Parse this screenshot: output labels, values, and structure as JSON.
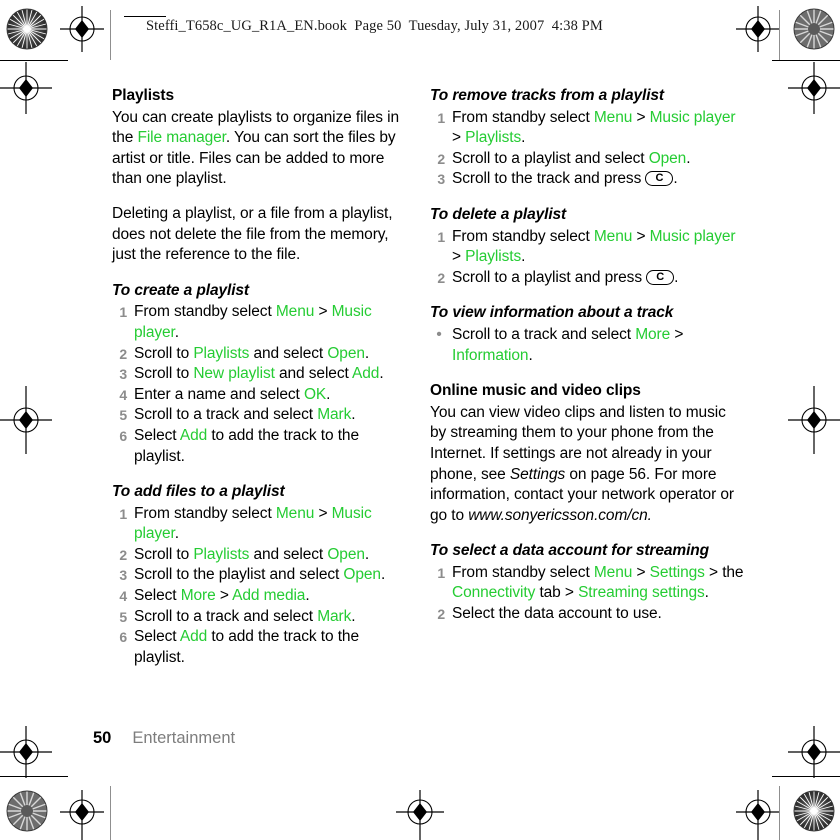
{
  "page_header": "Steffi_T658c_UG_R1A_EN.book  Page 50  Tuesday, July 31, 2007  4:38 PM",
  "colors": {
    "ui_term_green": "#25cc33",
    "step_number_gray": "#8c8c8c",
    "footer_title_gray": "#7d7d7d",
    "body_black": "#000000"
  },
  "left_column": {
    "playlists": {
      "title": "Playlists",
      "paragraph_1": {
        "part_1": "You can create playlists to organize files in the ",
        "ui_1": "File manager",
        "part_2": ". You can sort the files by artist or title. Files can be added to more than one playlist."
      },
      "paragraph_2": "Deleting a playlist, or a file from a playlist, does not delete the file from the memory, just the reference to the file."
    },
    "to_create_a_playlist": {
      "title": "To create a playlist",
      "steps": [
        {
          "num": "1",
          "segments": [
            {
              "t": "From standby select ",
              "s": "plain"
            },
            {
              "t": "Menu",
              "s": "ui"
            },
            {
              "t": " > ",
              "s": "plain"
            },
            {
              "t": "Music player",
              "s": "ui"
            },
            {
              "t": ".",
              "s": "plain"
            }
          ]
        },
        {
          "num": "2",
          "segments": [
            {
              "t": "Scroll to ",
              "s": "plain"
            },
            {
              "t": "Playlists",
              "s": "ui"
            },
            {
              "t": " and select ",
              "s": "plain"
            },
            {
              "t": "Open",
              "s": "ui"
            },
            {
              "t": ".",
              "s": "plain"
            }
          ]
        },
        {
          "num": "3",
          "segments": [
            {
              "t": "Scroll to ",
              "s": "plain"
            },
            {
              "t": "New playlist",
              "s": "ui"
            },
            {
              "t": " and select ",
              "s": "plain"
            },
            {
              "t": "Add",
              "s": "ui"
            },
            {
              "t": ".",
              "s": "plain"
            }
          ]
        },
        {
          "num": "4",
          "segments": [
            {
              "t": "Enter a name and select ",
              "s": "plain"
            },
            {
              "t": "OK",
              "s": "ui"
            },
            {
              "t": ".",
              "s": "plain"
            }
          ]
        },
        {
          "num": "5",
          "segments": [
            {
              "t": "Scroll to a track and select ",
              "s": "plain"
            },
            {
              "t": "Mark",
              "s": "ui"
            },
            {
              "t": ".",
              "s": "plain"
            }
          ]
        },
        {
          "num": "6",
          "segments": [
            {
              "t": "Select ",
              "s": "plain"
            },
            {
              "t": "Add",
              "s": "ui"
            },
            {
              "t": " to add the track to the playlist.",
              "s": "plain"
            }
          ]
        }
      ]
    },
    "to_add_files_to_a_playlist": {
      "title": "To add files to a playlist",
      "steps": [
        {
          "num": "1",
          "segments": [
            {
              "t": "From standby select ",
              "s": "plain"
            },
            {
              "t": "Menu",
              "s": "ui"
            },
            {
              "t": " > ",
              "s": "plain"
            },
            {
              "t": "Music player",
              "s": "ui"
            },
            {
              "t": ".",
              "s": "plain"
            }
          ]
        },
        {
          "num": "2",
          "segments": [
            {
              "t": "Scroll to ",
              "s": "plain"
            },
            {
              "t": "Playlists",
              "s": "ui"
            },
            {
              "t": " and select ",
              "s": "plain"
            },
            {
              "t": "Open",
              "s": "ui"
            },
            {
              "t": ".",
              "s": "plain"
            }
          ]
        },
        {
          "num": "3",
          "segments": [
            {
              "t": "Scroll to the playlist and select ",
              "s": "plain"
            },
            {
              "t": "Open",
              "s": "ui"
            },
            {
              "t": ".",
              "s": "plain"
            }
          ]
        },
        {
          "num": "4",
          "segments": [
            {
              "t": "Select ",
              "s": "plain"
            },
            {
              "t": "More",
              "s": "ui"
            },
            {
              "t": " > ",
              "s": "plain"
            },
            {
              "t": "Add media",
              "s": "ui"
            },
            {
              "t": ".",
              "s": "plain"
            }
          ]
        },
        {
          "num": "5",
          "segments": [
            {
              "t": "Scroll to a track and select ",
              "s": "plain"
            },
            {
              "t": "Mark",
              "s": "ui"
            },
            {
              "t": ".",
              "s": "plain"
            }
          ]
        },
        {
          "num": "6",
          "segments": [
            {
              "t": "Select ",
              "s": "plain"
            },
            {
              "t": "Add",
              "s": "ui"
            },
            {
              "t": " to add the track to the playlist.",
              "s": "plain"
            }
          ]
        }
      ]
    }
  },
  "right_column": {
    "to_remove_tracks": {
      "title": "To remove tracks from a playlist",
      "steps": [
        {
          "num": "1",
          "segments": [
            {
              "t": "From standby select ",
              "s": "plain"
            },
            {
              "t": "Menu",
              "s": "ui"
            },
            {
              "t": " > ",
              "s": "plain"
            },
            {
              "t": "Music player",
              "s": "ui"
            },
            {
              "t": " > ",
              "s": "plain"
            },
            {
              "t": "Playlists",
              "s": "ui"
            },
            {
              "t": ".",
              "s": "plain"
            }
          ]
        },
        {
          "num": "2",
          "segments": [
            {
              "t": "Scroll to a playlist and select ",
              "s": "plain"
            },
            {
              "t": "Open",
              "s": "ui"
            },
            {
              "t": ".",
              "s": "plain"
            }
          ]
        },
        {
          "num": "3",
          "segments": [
            {
              "t": "Scroll to the track and press ",
              "s": "plain"
            },
            {
              "t": "C",
              "s": "key"
            },
            {
              "t": ".",
              "s": "plain"
            }
          ]
        }
      ]
    },
    "to_delete_a_playlist": {
      "title": "To delete a playlist",
      "steps": [
        {
          "num": "1",
          "segments": [
            {
              "t": "From standby select ",
              "s": "plain"
            },
            {
              "t": "Menu",
              "s": "ui"
            },
            {
              "t": " > ",
              "s": "plain"
            },
            {
              "t": "Music player",
              "s": "ui"
            },
            {
              "t": " > ",
              "s": "plain"
            },
            {
              "t": "Playlists",
              "s": "ui"
            },
            {
              "t": ".",
              "s": "plain"
            }
          ]
        },
        {
          "num": "2",
          "segments": [
            {
              "t": "Scroll to a playlist and press ",
              "s": "plain"
            },
            {
              "t": "C",
              "s": "key"
            },
            {
              "t": ".",
              "s": "plain"
            }
          ]
        }
      ]
    },
    "to_view_information": {
      "title": "To view information about a track",
      "bullets": [
        {
          "bullet": "•",
          "segments": [
            {
              "t": "Scroll to a track and select ",
              "s": "plain"
            },
            {
              "t": "More",
              "s": "ui"
            },
            {
              "t": " > ",
              "s": "plain"
            },
            {
              "t": "Information",
              "s": "ui"
            },
            {
              "t": ".",
              "s": "plain"
            }
          ]
        }
      ]
    },
    "online_music": {
      "title": "Online music and video clips",
      "paragraph_segments": [
        {
          "t": "You can view video clips and listen to music by streaming them to your phone from the Internet. If settings are not already in your phone, see ",
          "s": "plain"
        },
        {
          "t": "Settings",
          "s": "em"
        },
        {
          "t": " on page 56. For more information, contact your network operator or go to ",
          "s": "plain"
        },
        {
          "t": "www.sonyericsson.com/cn.",
          "s": "em"
        }
      ]
    },
    "to_select_data_account": {
      "title": "To select a data account for streaming",
      "steps": [
        {
          "num": "1",
          "segments": [
            {
              "t": "From standby select ",
              "s": "plain"
            },
            {
              "t": "Menu",
              "s": "ui"
            },
            {
              "t": " > ",
              "s": "plain"
            },
            {
              "t": "Settings",
              "s": "ui"
            },
            {
              "t": " > the ",
              "s": "plain"
            },
            {
              "t": "Connectivity",
              "s": "ui"
            },
            {
              "t": " tab > ",
              "s": "plain"
            },
            {
              "t": "Streaming settings",
              "s": "ui"
            },
            {
              "t": ".",
              "s": "plain"
            }
          ]
        },
        {
          "num": "2",
          "segments": [
            {
              "t": "Select the data account to use.",
              "s": "plain"
            }
          ]
        }
      ]
    }
  },
  "footer": {
    "page_number": "50",
    "section_title": "Entertainment"
  }
}
